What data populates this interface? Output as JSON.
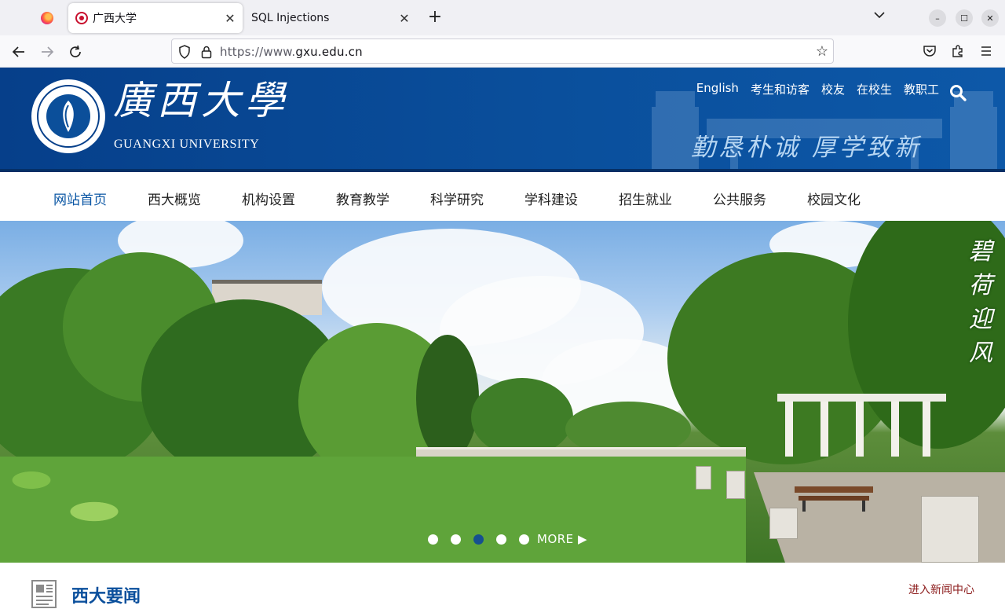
{
  "browser": {
    "tabs": [
      {
        "title": "广西大学",
        "active": true
      },
      {
        "title": "SQL Injections",
        "active": false
      }
    ],
    "url": {
      "prefix": "https://www.",
      "domain": "gxu.edu.cn"
    }
  },
  "site": {
    "name_cn": "廣西大學",
    "name_en": "GUANGXI UNIVERSITY",
    "motto": "勤恳朴诚 厚学致新",
    "top_links": [
      "English",
      "考生和访客",
      "校友",
      "在校生",
      "教职工"
    ],
    "nav": [
      "网站首页",
      "西大概览",
      "机构设置",
      "教育教学",
      "科学研究",
      "学科建设",
      "招生就业",
      "公共服务",
      "校园文化"
    ],
    "active_nav": "网站首页",
    "colors": {
      "brand_blue": "#0a4f9c",
      "accent_red": "#8b1a1a"
    }
  },
  "hero": {
    "caption": "碧荷迎风",
    "slide_count": 5,
    "active_slide": 3,
    "more_label": "MORE"
  },
  "news": {
    "title": "西大要闻",
    "more_label": "进入新闻中心"
  }
}
